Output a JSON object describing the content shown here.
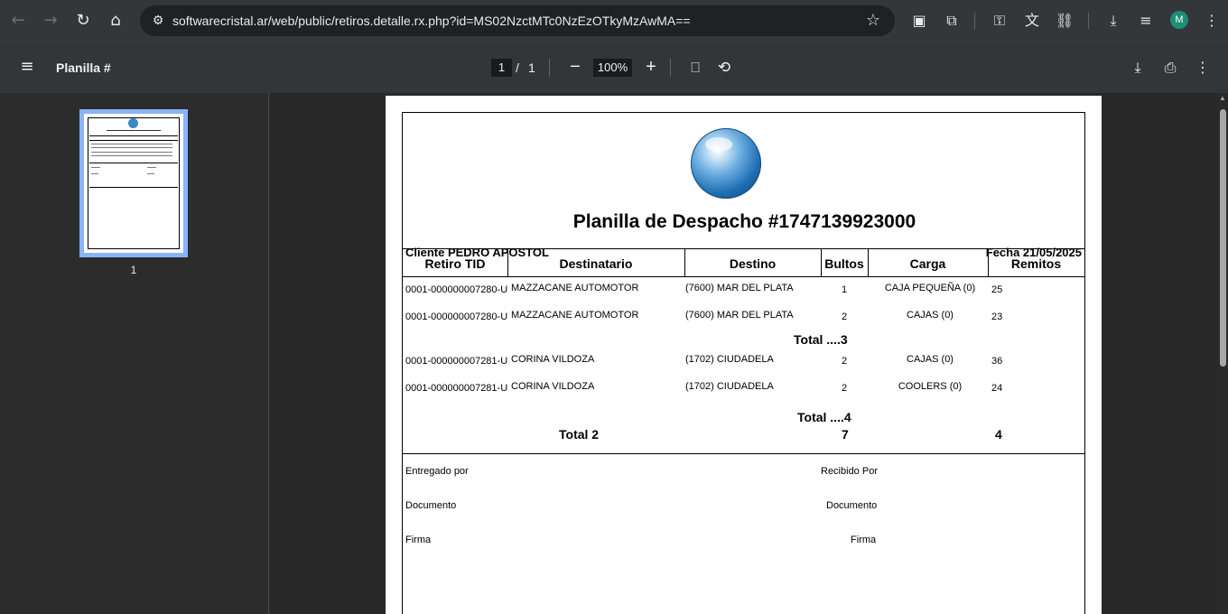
{
  "browser": {
    "url": "softwarecristal.ar/web/public/retiros.detalle.rx.php?id=MS02NzctMTc0NzEzOTkyMzAwMA==",
    "avatar_letter": "M",
    "icons": {
      "back": "←",
      "forward": "→",
      "reload": "↻",
      "home": "⌂",
      "site_info": "⚙",
      "star": "☆",
      "screencast": "▣",
      "extensions": "⧉",
      "key": "⚿",
      "translate": "文",
      "link": "⛓",
      "download": "⤓",
      "media": "≡",
      "more": "⋮"
    }
  },
  "pdf_toolbar": {
    "title": "Planilla #",
    "page_current": "1",
    "page_separator": "/",
    "page_total": "1",
    "zoom": "100%",
    "icons": {
      "menu": "≡",
      "zoom_out": "−",
      "zoom_in": "+",
      "fit": "⎕",
      "rotate": "⟲",
      "download": "⤓",
      "print": "⎙",
      "more": "⋮"
    }
  },
  "sidebar": {
    "thumbnail_label": "1"
  },
  "document": {
    "title": "Planilla de Despacho  #1747139923000",
    "cliente": "Cliente PEDRO APOSTOL",
    "fecha": "Fecha 21/05/2025",
    "columns": [
      "Retiro TID",
      "Destinatario",
      "Destino",
      "Bultos",
      "Carga",
      "Remitos"
    ],
    "rows": [
      {
        "tid": "0001-000000007280-U",
        "destinatario": "MAZZACANE AUTOMOTOR",
        "destino": "(7600) MAR DEL PLATA",
        "bultos": "1",
        "carga": "CAJA PEQUEÑA (0)",
        "remitos": "25"
      },
      {
        "tid": "0001-000000007280-U",
        "destinatario": "MAZZACANE AUTOMOTOR",
        "destino": "(7600) MAR DEL PLATA",
        "bultos": "2",
        "carga": "CAJAS (0)",
        "remitos": "23"
      },
      {
        "tid": "0001-000000007281-U",
        "destinatario": "CORINA VILDOZA",
        "destino": "(1702) CIUDADELA",
        "bultos": "2",
        "carga": "CAJAS (0)",
        "remitos": "36"
      },
      {
        "tid": "0001-000000007281-U",
        "destinatario": "CORINA VILDOZA",
        "destino": "(1702) CIUDADELA",
        "bultos": "2",
        "carga": "COOLERS (0)",
        "remitos": "24"
      }
    ],
    "subtotal_1": "Total ....3",
    "subtotal_2": "Total ....4",
    "grand_total_label": "Total  2",
    "grand_total_bultos": "7",
    "grand_total_remitos": "4",
    "signatures": {
      "entregado_por": "Entregado por",
      "recibido_por": "Recibido Por",
      "documento_left": "Documento",
      "documento_right": "Documento",
      "firma_left": "Firma",
      "firma_right": "Firma"
    }
  }
}
